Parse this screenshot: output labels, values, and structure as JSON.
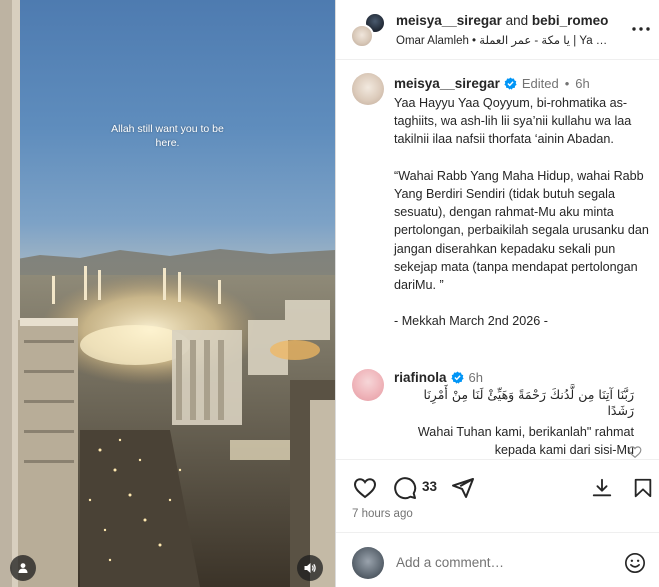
{
  "media": {
    "overlay_text": "Allah still want you to be here."
  },
  "header": {
    "author": "meisya__siregar",
    "joiner": "and",
    "collaborator": "bebi_romeo",
    "audio_line": "Omar Alamleh • يا مكة - عمر العملة | Ya …"
  },
  "caption": {
    "username": "meisya__siregar",
    "edited": "Edited",
    "dot": "•",
    "time": "6h",
    "paragraphs": [
      "Yaa Hayyu Yaa Qoyyum, bi-rohmatika as-taghiits, wa ash-lih lii sya’nii kullahu wa laa takilnii ilaa nafsii thorfata ‘ainin Abadan.",
      "“Wahai Rabb Yang Maha Hidup, wahai Rabb Yang Berdiri Sendiri (tidak butuh segala sesuatu), dengan rahmat-Mu aku minta pertolongan, perbaikilah segala urusanku dan jangan diserahkan kepadaku sekali pun sekejap mata (tanpa mendapat pertolongan dariMu. ”",
      "- Mekkah March 2nd 2026 -"
    ]
  },
  "comment": {
    "username": "riafinola",
    "time": "6h",
    "arabic": "رَبَّنَا آتِنَا مِن لَّدُنكَ رَحْمَةً وَهَيِّئْ لَنَا مِنْ أَمْرِنَا رَشَدًا",
    "translation": "Wahai Tuhan kami, berikanlah\" rahmat kepada kami dari sisi-Mu"
  },
  "actions": {
    "comment_count": "33",
    "time_ago": "7 hours ago"
  },
  "add_comment": {
    "placeholder": "Add a comment…"
  },
  "icons": {
    "more": "more-horizontal-icon",
    "like": "heart-icon",
    "comment": "comment-icon",
    "share": "send-icon",
    "download": "download-icon",
    "save": "bookmark-icon",
    "emoji": "emoji-icon",
    "user_tag": "user-icon",
    "audio": "speaker-icon",
    "verified": "verified-badge-icon"
  },
  "colors": {
    "verified": "#0095f6",
    "muted_text": "#737373",
    "text": "#262626"
  }
}
